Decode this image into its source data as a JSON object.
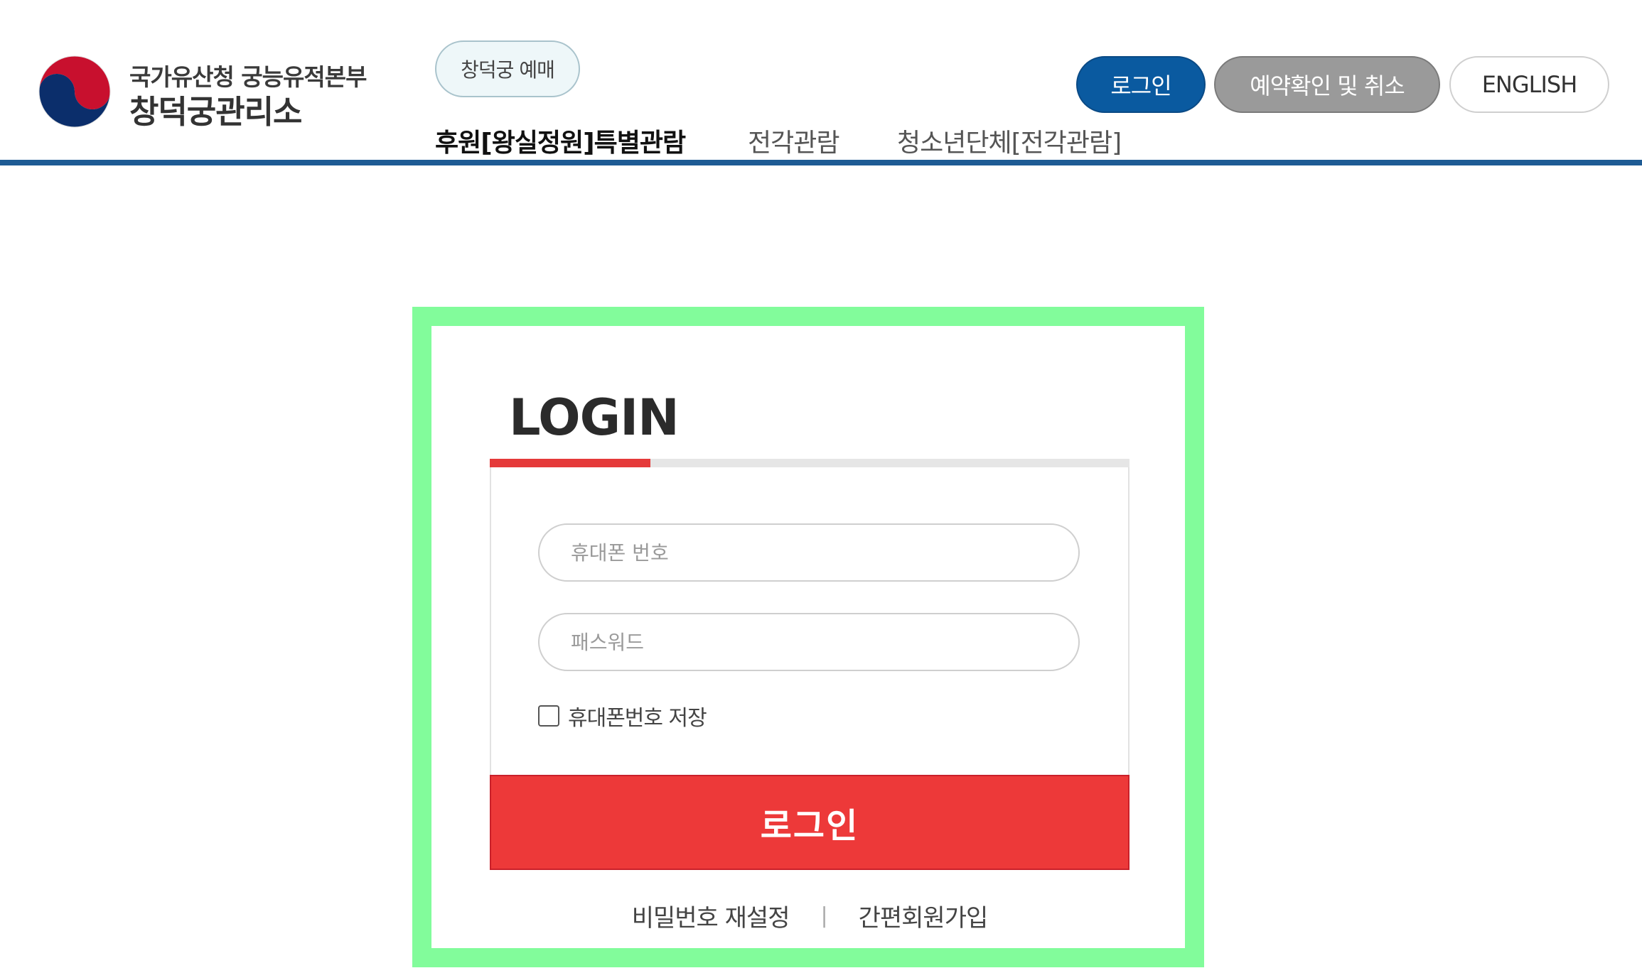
{
  "header": {
    "org_sub": "국가유산청 궁능유적본부",
    "org_main": "창덕궁관리소",
    "ticket_pill": "창덕궁 예매",
    "nav": [
      {
        "label": "후원[왕실정원]특별관람"
      },
      {
        "label": "전각관람"
      },
      {
        "label": "청소년단체[전각관람]"
      }
    ],
    "buttons": {
      "login": "로그인",
      "reserve": "예약확인 및 취소",
      "english": "ENGLISH"
    }
  },
  "login": {
    "title": "LOGIN",
    "phone_placeholder": "휴대폰 번호",
    "password_placeholder": "패스워드",
    "remember_label": "휴대폰번호 저장",
    "submit_label": "로그인",
    "reset_password": "비밀번호 재설정",
    "separator": "|",
    "signup": "간편회원가입"
  },
  "colors": {
    "primary_blue": "#0a5aa0",
    "header_line": "#1e5b94",
    "accent_red": "#ed3939",
    "frame_green": "#82fc9b"
  },
  "icons": {
    "emblem": "taegeuk-emblem-icon"
  }
}
